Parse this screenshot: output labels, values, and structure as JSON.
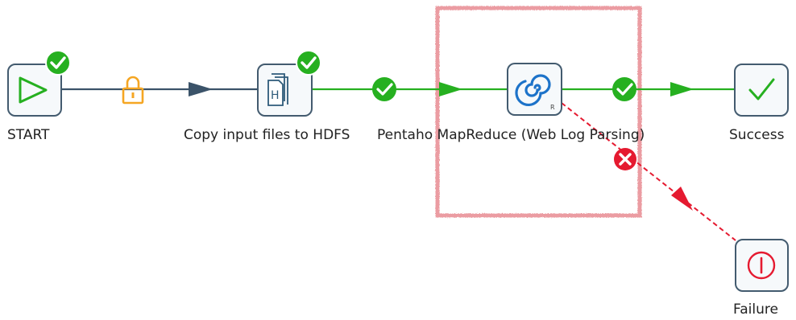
{
  "colors": {
    "hop_unconditional": "#3b5369",
    "hop_success": "#26b020",
    "hop_failure": "#e51a30",
    "node_border": "#435b6f",
    "node_fill": "#f6f9fb",
    "status_ok": "#26b020",
    "lock": "#f5a623",
    "highlight": "#e57b84",
    "start_icon": "#26b020",
    "job_icon": "#2e5b7a",
    "mapreduce_icon": "#1d73c9",
    "success_icon": "#26b020",
    "failure_icon": "#e51a30"
  },
  "nodes": [
    {
      "id": "start",
      "label": "START",
      "icon": "play-triangle-icon",
      "status": "success-check-badge-icon"
    },
    {
      "id": "copy",
      "label": "Copy input files to HDFS",
      "icon": "hadoop-copy-files-icon",
      "status": "success-check-badge-icon"
    },
    {
      "id": "mapreduce",
      "label": "Pentaho MapReduce (Web Log Parsing)",
      "icon": "mapreduce-swirl-icon",
      "sub_icon_text": "R"
    },
    {
      "id": "success",
      "label": "Success",
      "icon": "checkmark-icon"
    },
    {
      "id": "failure",
      "label": "Failure",
      "icon": "exclamation-circle-icon"
    }
  ],
  "hops": [
    {
      "from": "start",
      "to": "copy",
      "type": "unconditional",
      "marker": "lock-icon"
    },
    {
      "from": "copy",
      "to": "mapreduce",
      "type": "success",
      "marker": "check-circle-icon"
    },
    {
      "from": "mapreduce",
      "to": "success",
      "type": "success",
      "marker": "check-circle-icon"
    },
    {
      "from": "mapreduce",
      "to": "failure",
      "type": "failure",
      "marker": "x-circle-icon"
    }
  ]
}
